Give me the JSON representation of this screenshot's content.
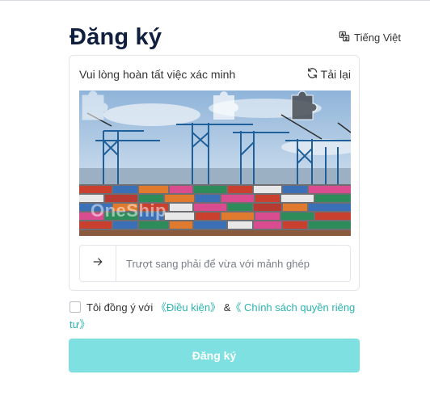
{
  "page": {
    "title": "Đăng ký",
    "language_label": "Tiếng Việt"
  },
  "captcha": {
    "prompt": "Vui lòng hoàn tất việc xác minh",
    "reload_label": "Tải lại",
    "watermark": "OneShip",
    "slider_hint": "Trượt sang phải để vừa với mảnh ghép"
  },
  "agreement": {
    "prefix": "Tôi đồng ý với",
    "terms_link": "《Điều kiện》",
    "joiner": "&",
    "privacy_link": "《 Chính sách quyền riêng tư》",
    "checked": false
  },
  "form": {
    "submit_label": "Đăng ký",
    "submit_enabled": false
  },
  "colors": {
    "accent": "#2bb3b0",
    "submit_disabled": "#7fe0e2",
    "title": "#0f1f3d"
  },
  "icons": {
    "language": "translate-icon",
    "reload": "refresh-icon",
    "slider": "arrow-right-icon"
  }
}
